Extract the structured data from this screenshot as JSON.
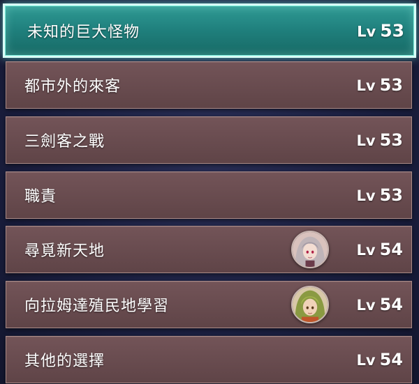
{
  "quests": [
    {
      "title": "未知的巨大怪物",
      "lv_label": "Lv",
      "level": "53",
      "selected": true
    },
    {
      "title": "都市外的來客",
      "lv_label": "Lv",
      "level": "53"
    },
    {
      "title": "三劍客之戰",
      "lv_label": "Lv",
      "level": "53"
    },
    {
      "title": "職責",
      "lv_label": "Lv",
      "level": "53"
    },
    {
      "title": "尋覓新天地",
      "lv_label": "Lv",
      "level": "54",
      "portrait_icon": "silver-haired-character-portrait-icon"
    },
    {
      "title": "向拉姆達殖民地學習",
      "lv_label": "Lv",
      "level": "54",
      "portrait_icon": "green-haired-character-portrait-icon"
    },
    {
      "title": "其他的選擇",
      "lv_label": "Lv",
      "level": "54"
    }
  ],
  "colors": {
    "selected_fill": "#1f7f7c",
    "selected_border": "#d8fff6",
    "row_fill": "#6a4d50",
    "row_border": "#a98a86",
    "background": "#1c2042"
  }
}
